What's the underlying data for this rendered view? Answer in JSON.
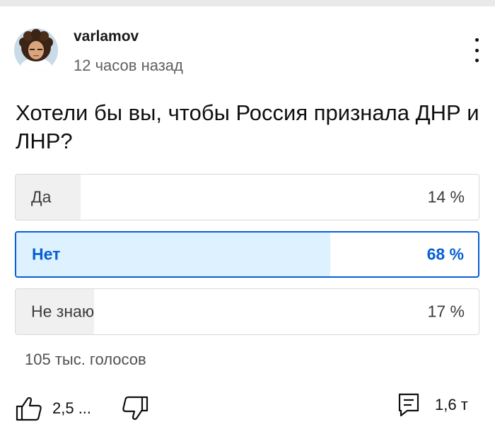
{
  "post": {
    "author": "varlamov",
    "time": "12 часов назад",
    "question": "Хотели бы вы, чтобы Россия признала ДНР и ЛНР?"
  },
  "poll": {
    "options": [
      {
        "label": "Да",
        "percent_text": "14 %",
        "percent": 14,
        "selected": false
      },
      {
        "label": "Нет",
        "percent_text": "68 %",
        "percent": 68,
        "selected": true
      },
      {
        "label": "Не знаю",
        "percent_text": "17 %",
        "percent": 17,
        "selected": false
      }
    ],
    "votes": "105 тыс. голосов"
  },
  "actions": {
    "likes": "2,5 ...",
    "comments": "1,6 т"
  },
  "icons": {
    "like": "thumbs-up-icon",
    "dislike": "thumbs-down-icon",
    "comment": "comment-icon",
    "menu": "more-vert-icon"
  },
  "colors": {
    "accent": "#065fd4",
    "selected_fill": "#def1ff",
    "option_fill": "#f0f0f0"
  }
}
